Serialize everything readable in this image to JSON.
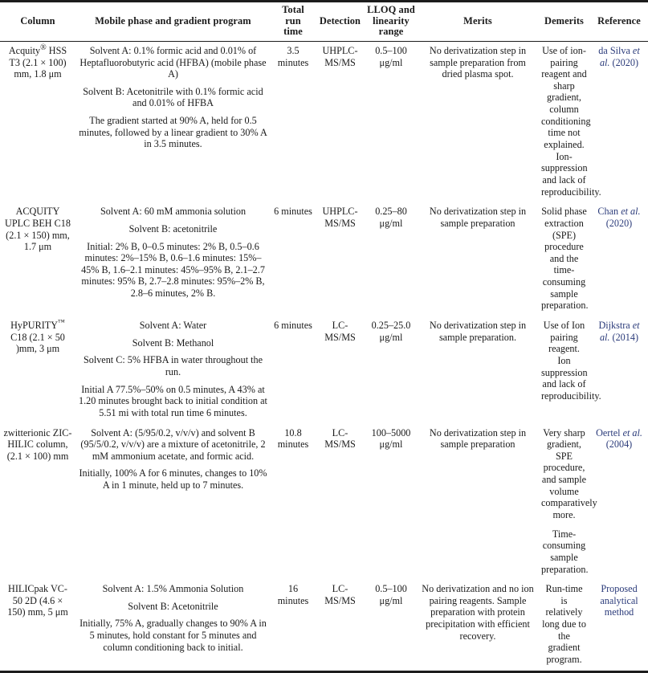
{
  "table": {
    "headers": [
      "Column",
      "Mobile phase and gradient program",
      "Total run time",
      "Detection",
      "LLOQ and linearity range",
      "Merits",
      "Demerits",
      "Reference"
    ],
    "header_parts": {
      "total_run_time": [
        "Total",
        "run",
        "time"
      ],
      "lloq": [
        "LLOQ and",
        "linearity",
        "range"
      ]
    },
    "rows": [
      {
        "column_name_parts": [
          "Acquity",
          "®",
          " HSS T3 (2.1 × 100) mm, 1.8 μm"
        ],
        "column_name": "Acquity® HSS T3 (2.1 × 100) mm, 1.8 μm",
        "mobile_phase": [
          "Solvent A: 0.1% formic acid and 0.01% of Heptafluorobutyric acid (HFBA) (mobile phase A)",
          "Solvent B: Acetonitrile with 0.1% formic acid and 0.01% of HFBA",
          "The gradient started at 90% A, held for 0.5 minutes, followed by a linear gradient to 30% A in 3.5 minutes."
        ],
        "total_run_time": "3.5 minutes",
        "detection": "UHPLC-MS/MS",
        "lloq_linearity": "0.5–100 μg/ml",
        "merits": [
          "No derivatization step in sample preparation from dried plasma spot."
        ],
        "demerits": [
          "Use of ion-pairing reagent and sharp gradient, column conditioning time not explained. Ion-suppression and lack of reproducibility."
        ],
        "reference": {
          "author": "da Silva ",
          "etal": "et al.",
          "year": " (2020)"
        }
      },
      {
        "column_name_parts": [
          "ACQUITY UPLC BEH C18 (2.1 × 150) mm, 1.7 μm",
          "",
          ""
        ],
        "column_name": "ACQUITY UPLC BEH C18 (2.1 × 150) mm, 1.7 μm",
        "mobile_phase": [
          "Solvent A: 60 mM ammonia solution",
          "Solvent B: acetonitrile",
          "Initial: 2% B, 0–0.5 minutes: 2% B, 0.5–0.6 minutes: 2%–15% B, 0.6–1.6 minutes: 15%–45% B, 1.6–2.1 minutes: 45%–95% B, 2.1–2.7 minutes: 95% B, 2.7–2.8 minutes: 95%–2% B, 2.8–6 minutes, 2% B."
        ],
        "total_run_time": "6 minutes",
        "detection": "UHPLC-MS/MS",
        "lloq_linearity": "0.25–80 μg/ml",
        "merits": [
          "No derivatization step in sample preparation"
        ],
        "demerits": [
          "Solid phase extraction (SPE) procedure and the time-consuming sample preparation."
        ],
        "reference": {
          "author": "Chan ",
          "etal": "et al.",
          "year": " (2020)"
        }
      },
      {
        "column_name_parts": [
          "HyPURITY",
          "™",
          " C18 (2.1 × 50 )mm, 3 μm"
        ],
        "column_name": "HyPURITY™ C18 (2.1 × 50 )mm, 3 μm",
        "mobile_phase": [
          "Solvent A: Water",
          "Solvent B: Methanol",
          "Solvent C: 5% HFBA in water throughout the run.",
          "Initial A 77.5%–50% on 0.5 minutes, A 43% at 1.20 minutes brought back to initial condition at 5.51 mi with total run time 6 minutes."
        ],
        "total_run_time": "6 minutes",
        "detection": "LC-MS/MS",
        "lloq_linearity": "0.25–25.0 μg/ml",
        "merits": [
          "No derivatization step in sample preparation."
        ],
        "demerits": [
          "Use of Ion pairing reagent. Ion suppression and lack of reproducibility."
        ],
        "reference": {
          "author": "Dijkstra ",
          "etal": "et al.",
          "year": " (2014)"
        }
      },
      {
        "column_name_parts": [
          "zwitterionic ZIC-HILIC column, (2.1 × 100) mm",
          "",
          ""
        ],
        "column_name": "zwitterionic ZIC-HILIC column, (2.1 × 100) mm",
        "mobile_phase": [
          "Solvent A: (5/95/0.2, v/v/v) and solvent B (95/5/0.2, v/v/v) are a mixture of acetonitrile, 2 mM ammonium acetate, and formic acid.",
          "Initially, 100% A for 6 minutes, changes to 10% A in 1 minute, held up to 7 minutes."
        ],
        "total_run_time": "10.8 minutes",
        "detection": "LC-MS/MS",
        "lloq_linearity": "100–5000 μg/ml",
        "merits": [
          "No derivatization step in sample preparation"
        ],
        "demerits": [
          "Very sharp gradient, SPE procedure, and sample volume comparatively more.",
          "Time-consuming sample preparation."
        ],
        "reference": {
          "author": "Oertel ",
          "etal": "et al.",
          "year": " (2004)"
        }
      },
      {
        "column_name_parts": [
          "HILICpak VC-50 2D (4.6 × 150) mm, 5 μm",
          "",
          ""
        ],
        "column_name": "HILICpak VC-50 2D (4.6 × 150) mm, 5 μm",
        "mobile_phase": [
          "Solvent A: 1.5% Ammonia Solution",
          "Solvent B: Acetonitrile",
          "Initially, 75% A, gradually changes to 90% A in 5 minutes, hold constant for 5 minutes and column conditioning back to initial."
        ],
        "total_run_time": "16 minutes",
        "detection": "LC-MS/MS",
        "lloq_linearity": "0.5–100 μg/ml",
        "merits": [
          "No derivatization and no ion pairing reagents. Sample preparation with protein precipitation with efficient recovery."
        ],
        "demerits": [
          "Run-time is relatively long due to the gradient program."
        ],
        "reference": {
          "author": "Proposed analytical method",
          "etal": "",
          "year": ""
        }
      }
    ]
  },
  "colors": {
    "text": "#1a1a1a",
    "reference": "#2b3b7a",
    "rule": "#1c1c1c",
    "background": "#ffffff"
  }
}
